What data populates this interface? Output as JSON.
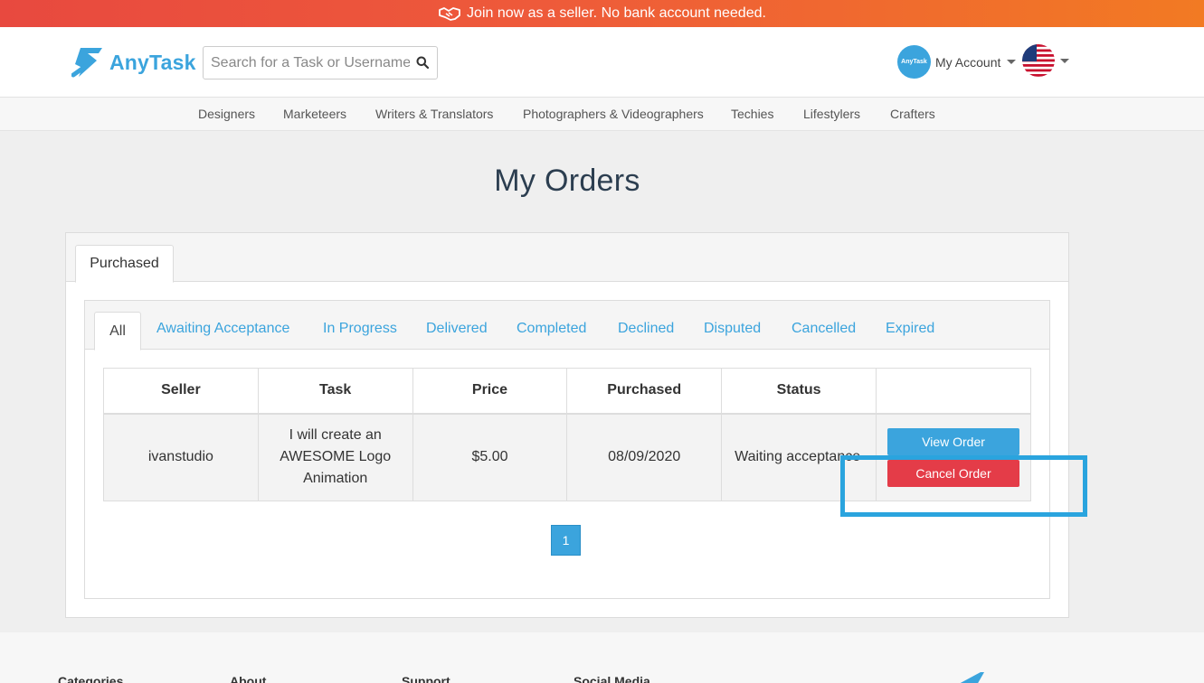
{
  "promo": {
    "text": "Join now as a seller. No bank account needed.",
    "icon": "handshake-icon"
  },
  "header": {
    "logo_text": "AnyTask",
    "search_placeholder": "Search for a Task or Username",
    "account_label": "My Account",
    "avatar_text": "AnyTask",
    "language": "us-flag"
  },
  "categories": [
    "Designers",
    "Marketeers",
    "Writers & Translators",
    "Photographers & Videographers",
    "Techies",
    "Lifestylers",
    "Crafters"
  ],
  "page_title": "My Orders",
  "main_tab": "Purchased",
  "status_tabs": [
    "All",
    "Awaiting Acceptance",
    "In Progress",
    "Delivered",
    "Completed",
    "Declined",
    "Disputed",
    "Cancelled",
    "Expired"
  ],
  "table": {
    "headers": [
      "Seller",
      "Task",
      "Price",
      "Purchased",
      "Status",
      ""
    ],
    "rows": [
      {
        "seller": "ivanstudio",
        "task": "I will create an AWESOME Logo Animation",
        "price": "$5.00",
        "purchased": "08/09/2020",
        "status": "Waiting acceptance",
        "view_label": "View Order",
        "cancel_label": "Cancel Order"
      }
    ]
  },
  "pagination": {
    "current": "1"
  },
  "footer": [
    "Categories",
    "About",
    "Support",
    "Social Media"
  ],
  "colors": {
    "brand": "#3ba4dd",
    "cancel": "#e43c48",
    "promo_start": "#e8493f",
    "promo_end": "#f27a23"
  }
}
